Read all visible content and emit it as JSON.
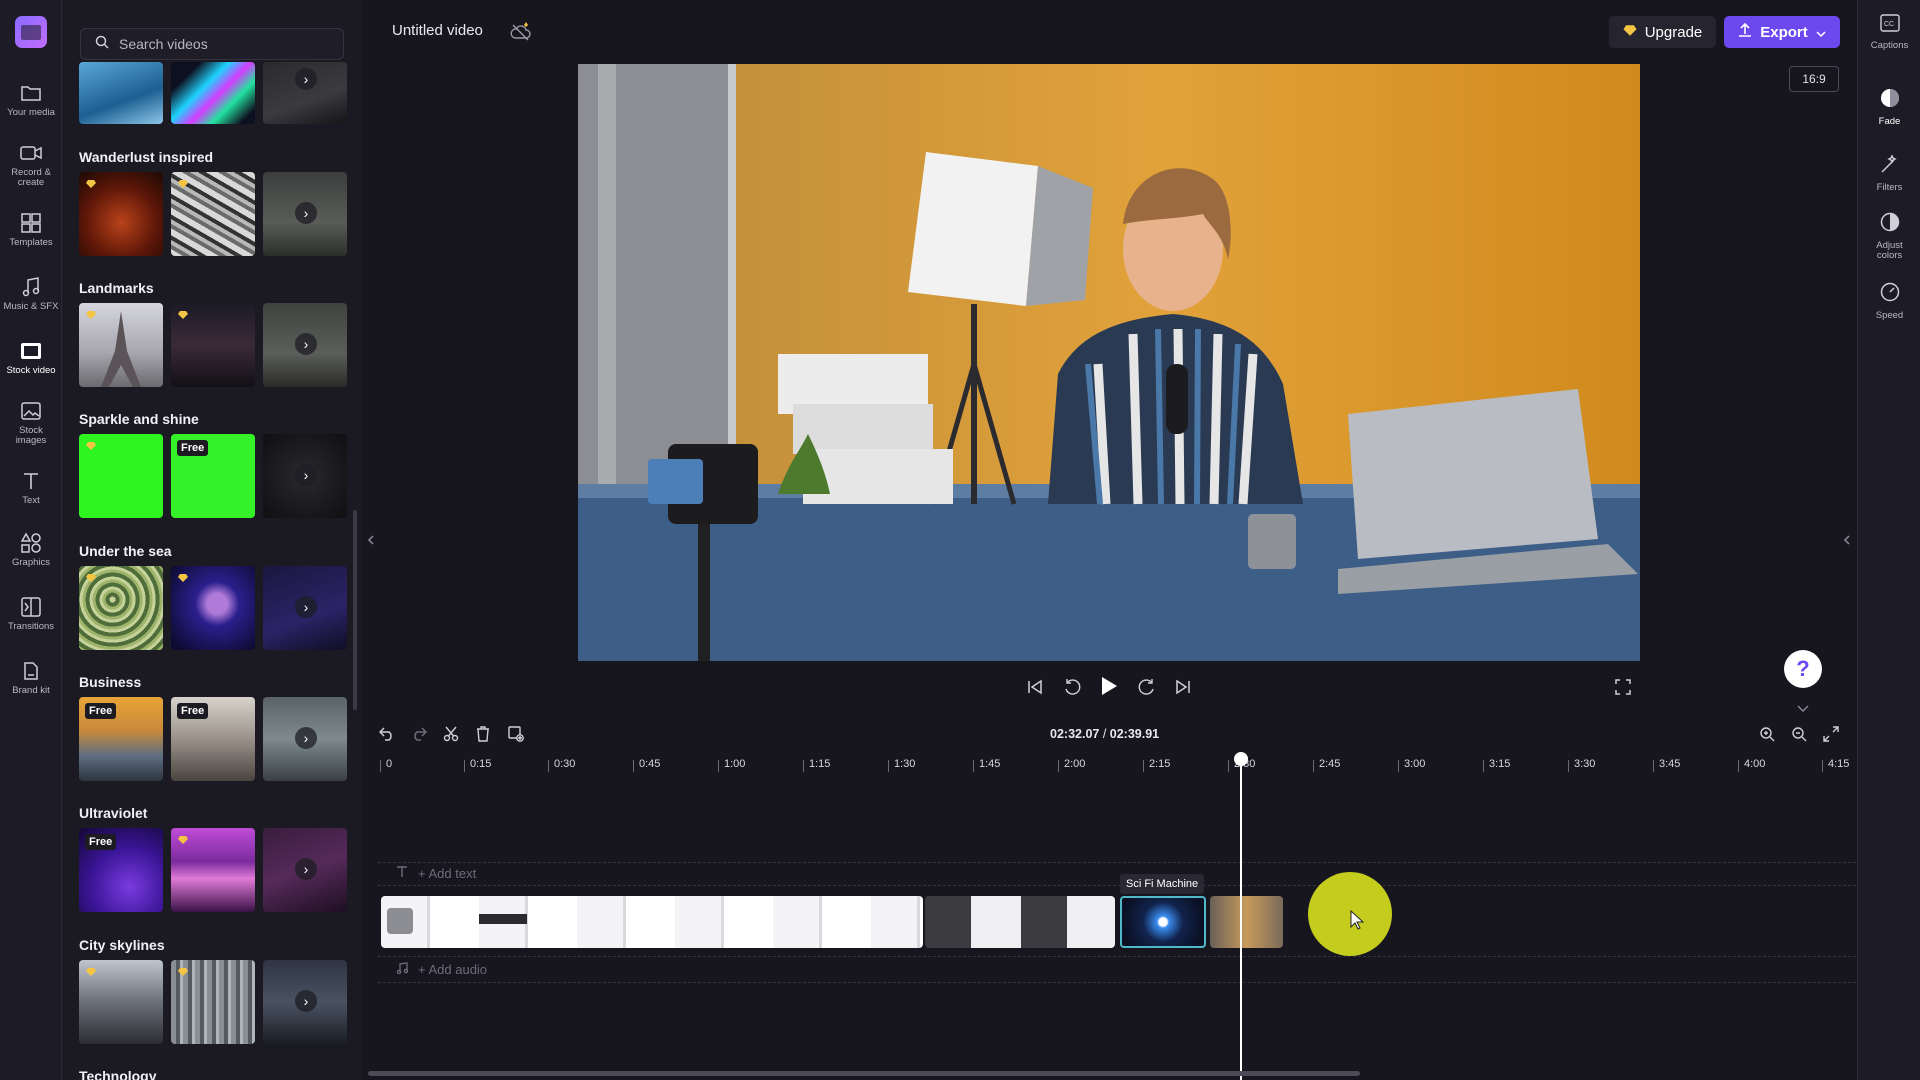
{
  "app": {
    "title": "Untitled video",
    "accent": "#6b49ef",
    "upgrade_label": "Upgrade",
    "export_label": "Export",
    "aspect_ratio": "16:9",
    "help_label": "?"
  },
  "left_rail": [
    {
      "label": "Your media",
      "icon": "folder-icon"
    },
    {
      "label": "Record & create",
      "icon": "camera-icon"
    },
    {
      "label": "Templates",
      "icon": "templates-icon"
    },
    {
      "label": "Music & SFX",
      "icon": "music-icon"
    },
    {
      "label": "Stock video",
      "icon": "film-icon",
      "active": true
    },
    {
      "label": "Stock images",
      "icon": "image-icon"
    },
    {
      "label": "Text",
      "icon": "text-icon"
    },
    {
      "label": "Graphics",
      "icon": "shapes-icon"
    },
    {
      "label": "Transitions",
      "icon": "transitions-icon"
    },
    {
      "label": "Brand kit",
      "icon": "brand-kit-icon"
    }
  ],
  "right_rail": [
    {
      "label": "Captions",
      "icon": "captions-icon"
    },
    {
      "label": "Fade",
      "icon": "fade-icon"
    },
    {
      "label": "Filters",
      "icon": "filters-icon"
    },
    {
      "label": "Adjust colors",
      "icon": "adjust-colors-icon"
    },
    {
      "label": "Speed",
      "icon": "speed-icon"
    }
  ],
  "search": {
    "placeholder": "Search videos"
  },
  "sections": [
    {
      "title": "Wanderlust inspired"
    },
    {
      "title": "Landmarks"
    },
    {
      "title": "Sparkle and shine",
      "badge": "Free"
    },
    {
      "title": "Under the sea"
    },
    {
      "title": "Business",
      "badges": [
        "Free",
        "Free"
      ]
    },
    {
      "title": "Ultraviolet",
      "badge": "Free"
    },
    {
      "title": "City skylines"
    },
    {
      "title": "Technology"
    }
  ],
  "badges": {
    "free": "Free"
  },
  "timeline": {
    "current_time": "02:32.07",
    "separator": " / ",
    "total_time": "02:39.91",
    "ruler_ticks": [
      "0",
      "0:15",
      "0:30",
      "0:45",
      "1:00",
      "1:15",
      "1:30",
      "1:45",
      "2:00",
      "2:15",
      "2:30",
      "2:45",
      "3:00",
      "3:15",
      "3:30",
      "3:45",
      "4:00",
      "4:15"
    ],
    "add_text": "+ Add text",
    "add_audio": "+ Add audio",
    "clip_tooltip": "Sci Fi Machine"
  }
}
